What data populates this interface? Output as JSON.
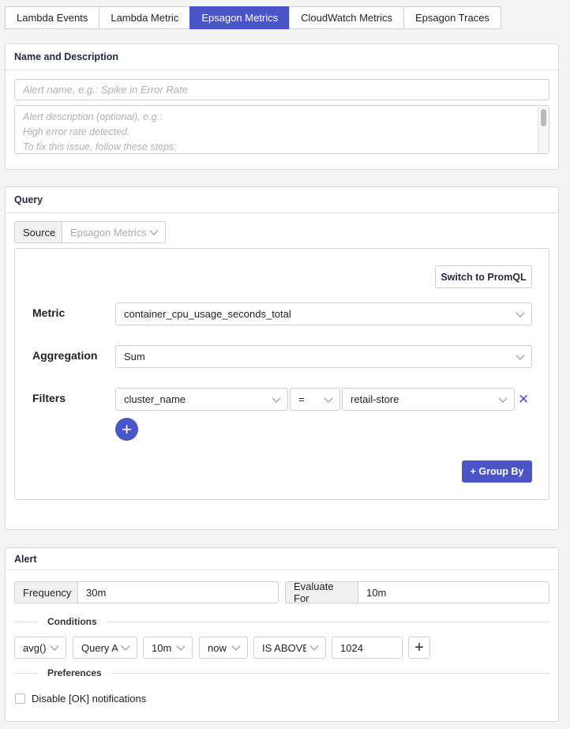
{
  "tabs": [
    {
      "label": "Lambda Events",
      "active": false
    },
    {
      "label": "Lambda Metric",
      "active": false
    },
    {
      "label": "Epsagon Metrics",
      "active": true
    },
    {
      "label": "CloudWatch Metrics",
      "active": false
    },
    {
      "label": "Epsagon Traces",
      "active": false
    }
  ],
  "name_section": {
    "title": "Name and Description",
    "name_placeholder": "Alert name, e.g.: Spike in Error Rate",
    "desc_lines": [
      "Alert description  (optional), e.g.:",
      "High error rate detected.",
      "To fix this issue, follow these steps:"
    ]
  },
  "query": {
    "title": "Query",
    "source_label": "Source",
    "source_value": "Epsagon Metrics",
    "switch_label": "Switch to PromQL",
    "metric_label": "Metric",
    "metric_value": "container_cpu_usage_seconds_total",
    "aggregation_label": "Aggregation",
    "aggregation_value": "Sum",
    "filters_label": "Filters",
    "filter": {
      "key": "cluster_name",
      "op": "=",
      "value": "retail-store"
    },
    "add_filter_symbol": "+",
    "remove_filter_symbol": "✕",
    "group_by_label": "+ Group By"
  },
  "alert": {
    "title": "Alert",
    "frequency_label": "Frequency",
    "frequency_value": "30m",
    "evaluate_label": "Evaluate For",
    "evaluate_value": "10m",
    "conditions_label": "Conditions",
    "conditions": {
      "func": "avg()",
      "query": "Query A",
      "window": "10m",
      "until": "now",
      "comparator": "IS ABOVE",
      "threshold": "1024"
    },
    "add_condition_symbol": "+",
    "preferences_label": "Preferences",
    "disable_ok_label": "Disable [OK] notifications",
    "disable_ok_checked": false
  },
  "colors": {
    "accent": "#4a56c8",
    "border": "#cfcfcf",
    "background": "#f4f4f4"
  }
}
